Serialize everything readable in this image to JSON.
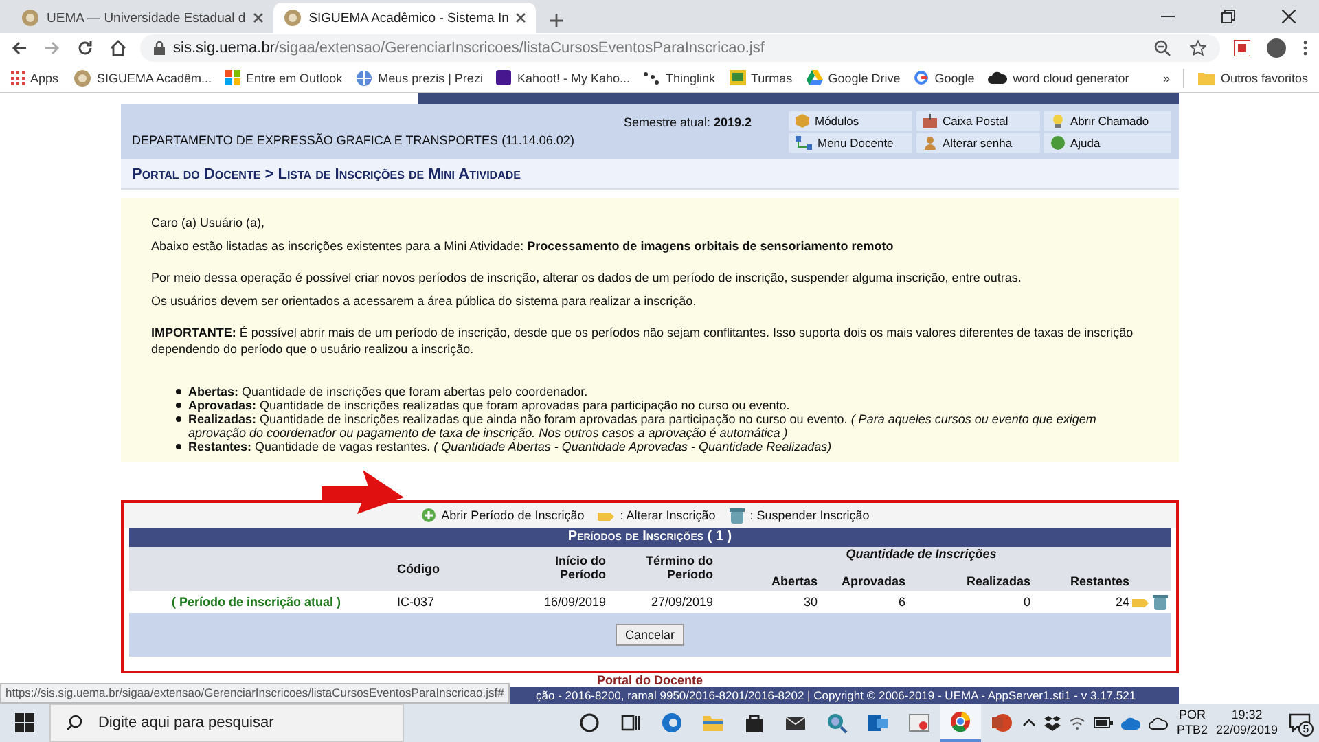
{
  "browser": {
    "tabs": [
      {
        "title": "UEMA — Universidade Estadual d",
        "selected": false
      },
      {
        "title": "SIGUEMA Acadêmico - Sistema In",
        "selected": true
      }
    ],
    "url": {
      "host": "sis.sig.uema.br",
      "path": "/sigaa/extensao/GerenciarInscricoes/listaCursosEventosParaInscricao.jsf"
    },
    "bookmarks": [
      "Apps",
      "SIGUEMA Acadêm...",
      "Entre em Outlook",
      "Meus prezis | Prezi",
      "Kahoot! - My Kaho...",
      "Thinglink",
      "Turmas",
      "Google Drive",
      "Google",
      "word cloud generator"
    ],
    "overflow": "»",
    "other_bookmarks": "Outros favoritos"
  },
  "header": {
    "department": "DEPARTAMENTO DE EXPRESSÃO GRAFICA E TRANSPORTES (11.14.06.02)",
    "semester_label": "Semestre atual:",
    "semester": "2019.2",
    "menu": [
      "Módulos",
      "Caixa Postal",
      "Abrir Chamado",
      "Menu Docente",
      "Alterar senha",
      "Ajuda"
    ]
  },
  "breadcrumb": "Portal do Docente > Lista de Inscrições de Mini Atividade",
  "message": {
    "blocks": [
      [
        "Caro (a) Usuário (a),",
        "Abaixo estão listadas as inscrições existentes para a Mini Atividade: **Processamento de imagens orbitais de sensoriamento remoto**"
      ],
      [
        "Por meio dessa operação é possível criar novos períodos de inscrição, alterar os dados de um período de inscrição, suspender alguma inscrição, entre outras.",
        "Os usuários devem ser orientados a acessarem a área pública do sistema para realizar a inscrição."
      ],
      [
        "**IMPORTANTE:** É possível abrir mais de um período de inscrição, desde que os períodos não sejam conflitantes. Isso suporta dois os mais valores diferentes de taxas de inscrição dependendo do período que o usuário realizou a inscrição."
      ]
    ],
    "legend": [
      "**Abertas:** Quantidade de inscrições que foram abertas pelo coordenador.",
      "**Aprovadas:** Quantidade de inscrições realizadas que foram aprovadas para participação no curso ou evento.",
      "**Realizadas:** Quantidade de inscrições realizadas que ainda não foram aprovadas para participação no curso ou evento. *( Para aqueles cursos ou evento que exigem aprovação do coordenador ou pagamento de taxa de inscrição. Nos outros casos a aprovação é automática )*",
      "**Restantes:** Quantidade de vagas restantes. *( Quantidade Abertas - Quantidade Aprovadas - Quantidade Realizadas)*"
    ]
  },
  "actions": [
    "Abrir Período de Inscrição",
    ": Alterar Inscrição",
    ": Suspender Inscrição"
  ],
  "table": {
    "title": "Períodos de Inscrições ( 1 )",
    "group_header": "Quantidade de Inscrições",
    "columns": [
      "Código",
      "Início do Período",
      "Término do Período",
      "Abertas",
      "Aprovadas",
      "Realizadas",
      "Restantes"
    ],
    "rows": [
      {
        "status": "( Período de inscrição atual )",
        "cells": [
          "IC-037",
          "16/09/2019",
          "27/09/2019",
          "30",
          "6",
          "0",
          "24"
        ]
      }
    ],
    "button": "Cancelar"
  },
  "footer_link": "Portal do Docente",
  "footer": "ção - 2016-8200, ramal 9950/2016-8201/2016-8202 | Copyright © 2006-2019 - UEMA - AppServer1.sti1 - v 3.17.521",
  "status_url": "https://sis.sig.uema.br/sigaa/extensao/GerenciarInscricoes/listaCursosEventosParaInscricao.jsf#",
  "taskbar": {
    "search_placeholder": "Digite aqui para pesquisar",
    "apps": [
      {
        "selected": false
      },
      {
        "selected": false
      },
      {
        "selected": false
      },
      {
        "selected": false
      },
      {
        "selected": false
      },
      {
        "selected": false
      },
      {
        "selected": false
      },
      {
        "selected": false
      },
      {
        "selected": false
      },
      {
        "selected": true
      },
      {
        "selected": false
      }
    ],
    "language": [
      "POR",
      "PTB2"
    ],
    "time": "19:32",
    "date": "22/09/2019",
    "notifications": "5"
  }
}
